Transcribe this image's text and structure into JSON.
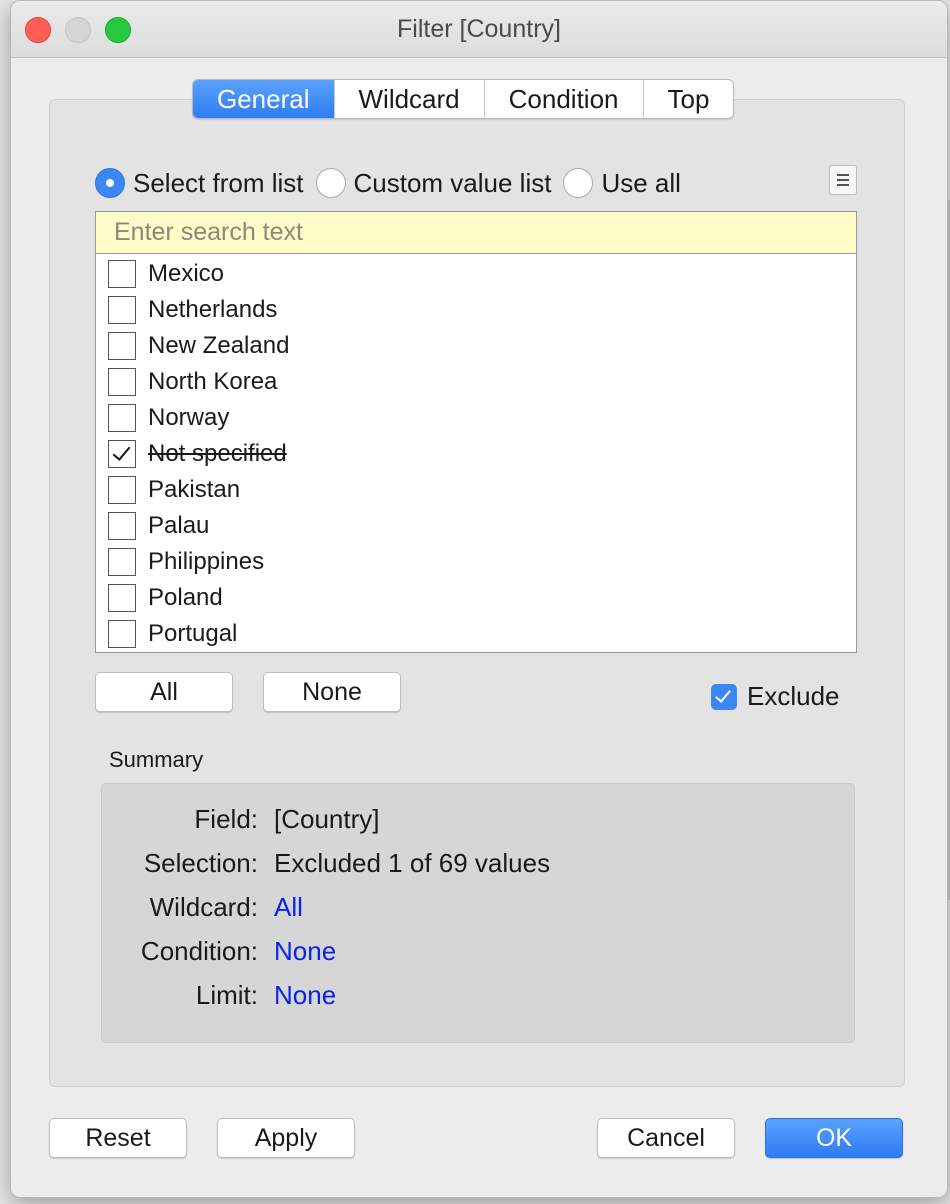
{
  "window": {
    "title": "Filter [Country]"
  },
  "tabs": [
    {
      "label": "General",
      "active": true
    },
    {
      "label": "Wildcard",
      "active": false
    },
    {
      "label": "Condition",
      "active": false
    },
    {
      "label": "Top",
      "active": false
    }
  ],
  "mode": {
    "options": [
      {
        "label": "Select from list",
        "checked": true
      },
      {
        "label": "Custom value list",
        "checked": false
      },
      {
        "label": "Use all",
        "checked": false
      }
    ]
  },
  "search": {
    "placeholder": "Enter search text",
    "value": ""
  },
  "list": {
    "items": [
      {
        "label": "Mexico",
        "checked": false
      },
      {
        "label": "Netherlands",
        "checked": false
      },
      {
        "label": "New Zealand",
        "checked": false
      },
      {
        "label": "North Korea",
        "checked": false
      },
      {
        "label": "Norway",
        "checked": false
      },
      {
        "label": "Not specified",
        "checked": true
      },
      {
        "label": "Pakistan",
        "checked": false
      },
      {
        "label": "Palau",
        "checked": false
      },
      {
        "label": "Philippines",
        "checked": false
      },
      {
        "label": "Poland",
        "checked": false
      },
      {
        "label": "Portugal",
        "checked": false
      }
    ]
  },
  "list_actions": {
    "all_label": "All",
    "none_label": "None"
  },
  "exclude": {
    "label": "Exclude",
    "checked": true
  },
  "summary": {
    "heading": "Summary",
    "field_key": "Field:",
    "field_value": "[Country]",
    "selection_key": "Selection:",
    "selection_value": "Excluded 1 of 69 values",
    "wildcard_key": "Wildcard:",
    "wildcard_value": "All",
    "condition_key": "Condition:",
    "condition_value": "None",
    "limit_key": "Limit:",
    "limit_value": "None"
  },
  "footer": {
    "reset_label": "Reset",
    "apply_label": "Apply",
    "cancel_label": "Cancel",
    "ok_label": "OK"
  },
  "colors": {
    "accent": "#3b87f6",
    "link": "#0a23e8",
    "search_bg": "#fffcc8"
  }
}
